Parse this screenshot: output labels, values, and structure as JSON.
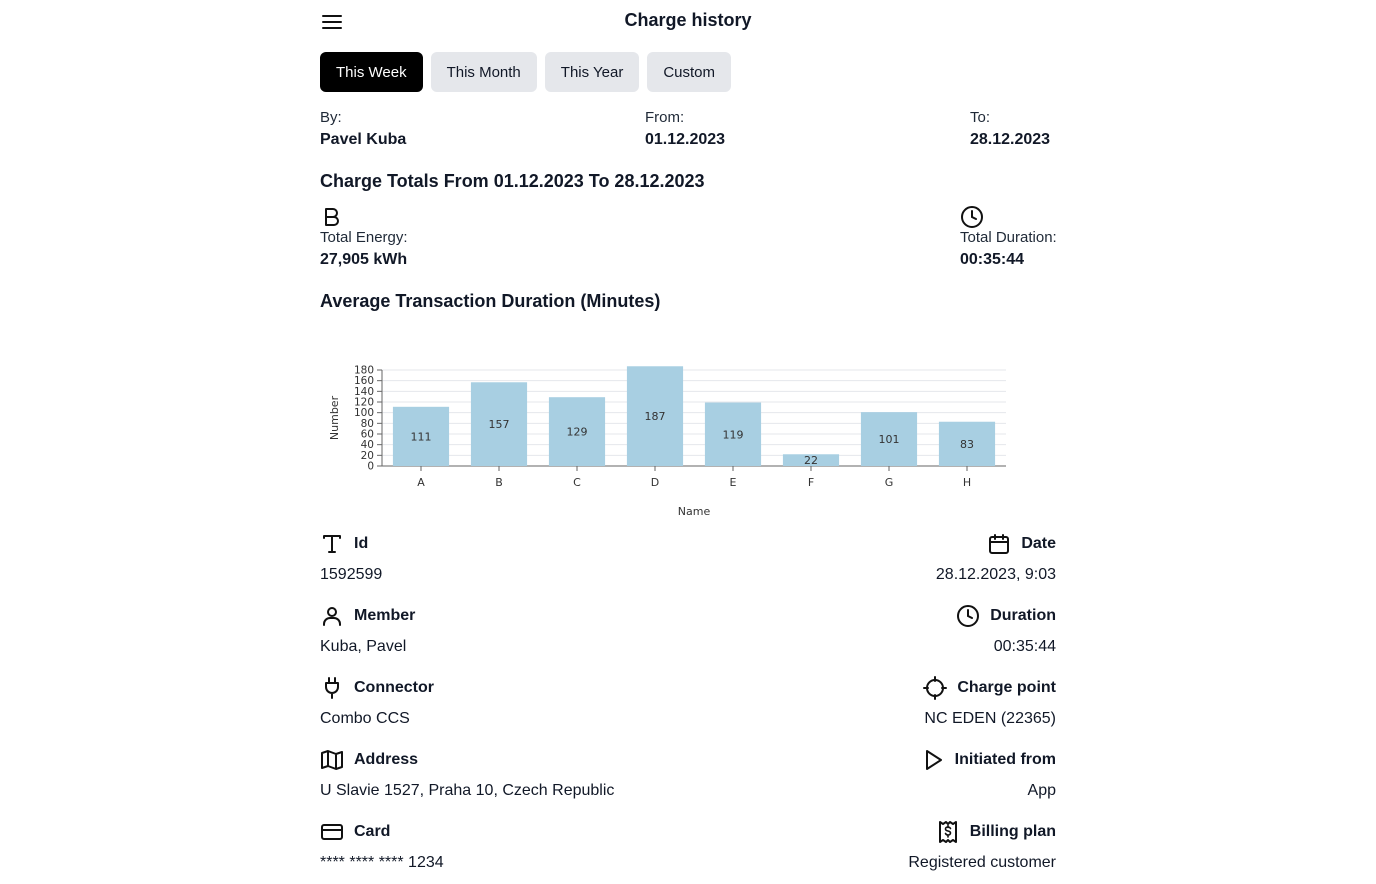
{
  "header": {
    "title": "Charge history",
    "menu_icon": "hamburger-menu-icon"
  },
  "tabs": [
    {
      "label": "This Week",
      "active": true
    },
    {
      "label": "This Month",
      "active": false
    },
    {
      "label": "This Year",
      "active": false
    },
    {
      "label": "Custom",
      "active": false
    }
  ],
  "filter": {
    "by_label": "By:",
    "by_value": "Pavel Kuba",
    "from_label": "From:",
    "from_value": "01.12.2023",
    "to_label": "To:",
    "to_value": "28.12.2023"
  },
  "totals": {
    "heading": "Charge Totals From 01.12.2023 To 28.12.2023",
    "energy_icon": "bold-b-icon",
    "energy_label": "Total Energy:",
    "energy_value": "27,905 kWh",
    "duration_icon": "clock-icon",
    "duration_label": "Total Duration:",
    "duration_value": "00:35:44"
  },
  "chart_heading": "Average Transaction Duration (Minutes)",
  "chart_data": {
    "type": "bar",
    "categories": [
      "A",
      "B",
      "C",
      "D",
      "E",
      "F",
      "G",
      "H"
    ],
    "values": [
      111,
      157,
      129,
      187,
      119,
      22,
      101,
      83
    ],
    "xlabel": "Name",
    "ylabel": "Number",
    "ylim": [
      0,
      180
    ],
    "yticks": [
      0,
      20,
      40,
      60,
      80,
      100,
      120,
      140,
      160,
      180
    ],
    "grid": true,
    "bar_color": "#a8cfe2"
  },
  "details": {
    "id": {
      "icon": "text-t-icon",
      "label": "Id",
      "value": "1592599"
    },
    "date": {
      "icon": "calendar-icon",
      "label": "Date",
      "value": "28.12.2023, 9:03"
    },
    "member": {
      "icon": "user-icon",
      "label": "Member",
      "value": "Kuba, Pavel"
    },
    "duration": {
      "icon": "clock-icon",
      "label": "Duration",
      "value": "00:35:44"
    },
    "connector": {
      "icon": "plug-icon",
      "label": "Connector",
      "value": "Combo CCS"
    },
    "charge_point": {
      "icon": "crosshair-icon",
      "label": "Charge point",
      "value": "NC EDEN (22365)"
    },
    "address": {
      "icon": "map-icon",
      "label": "Address",
      "value": "U Slavie 1527, Praha 10, Czech Republic"
    },
    "initiated_from": {
      "icon": "play-icon",
      "label": "Initiated from",
      "value": "App"
    },
    "card": {
      "icon": "credit-card-icon",
      "label": "Card",
      "value": "**** **** **** 1234"
    },
    "billing_plan": {
      "icon": "receipt-dollar-icon",
      "label": "Billing plan",
      "value": "Registered customer"
    }
  }
}
